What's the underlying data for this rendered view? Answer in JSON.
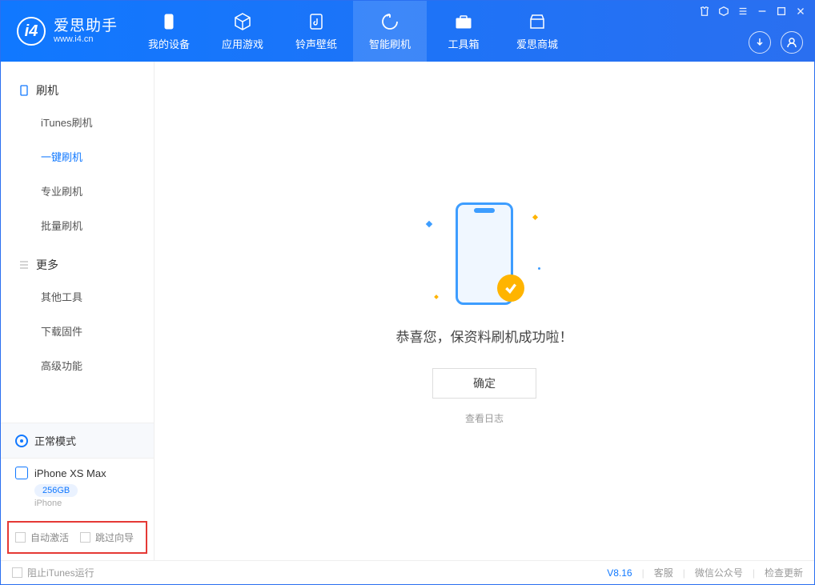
{
  "logo": {
    "title": "爱思助手",
    "subtitle": "www.i4.cn"
  },
  "nav": [
    {
      "label": "我的设备",
      "icon": "device"
    },
    {
      "label": "应用游戏",
      "icon": "cube"
    },
    {
      "label": "铃声壁纸",
      "icon": "music"
    },
    {
      "label": "智能刷机",
      "icon": "refresh",
      "active": true
    },
    {
      "label": "工具箱",
      "icon": "toolbox"
    },
    {
      "label": "爱思商城",
      "icon": "store"
    }
  ],
  "sidebar": {
    "section1": {
      "title": "刷机",
      "items": [
        "iTunes刷机",
        "一键刷机",
        "专业刷机",
        "批量刷机"
      ],
      "activeIndex": 1
    },
    "section2": {
      "title": "更多",
      "items": [
        "其他工具",
        "下载固件",
        "高级功能"
      ]
    }
  },
  "device": {
    "mode": "正常模式",
    "name": "iPhone XS Max",
    "capacity": "256GB",
    "type": "iPhone"
  },
  "checkboxes": {
    "autoActivate": "自动激活",
    "skipGuide": "跳过向导"
  },
  "main": {
    "successText": "恭喜您，保资料刷机成功啦！",
    "okButton": "确定",
    "viewLog": "查看日志"
  },
  "footer": {
    "blockITunes": "阻止iTunes运行",
    "version": "V8.16",
    "links": [
      "客服",
      "微信公众号",
      "检查更新"
    ]
  }
}
